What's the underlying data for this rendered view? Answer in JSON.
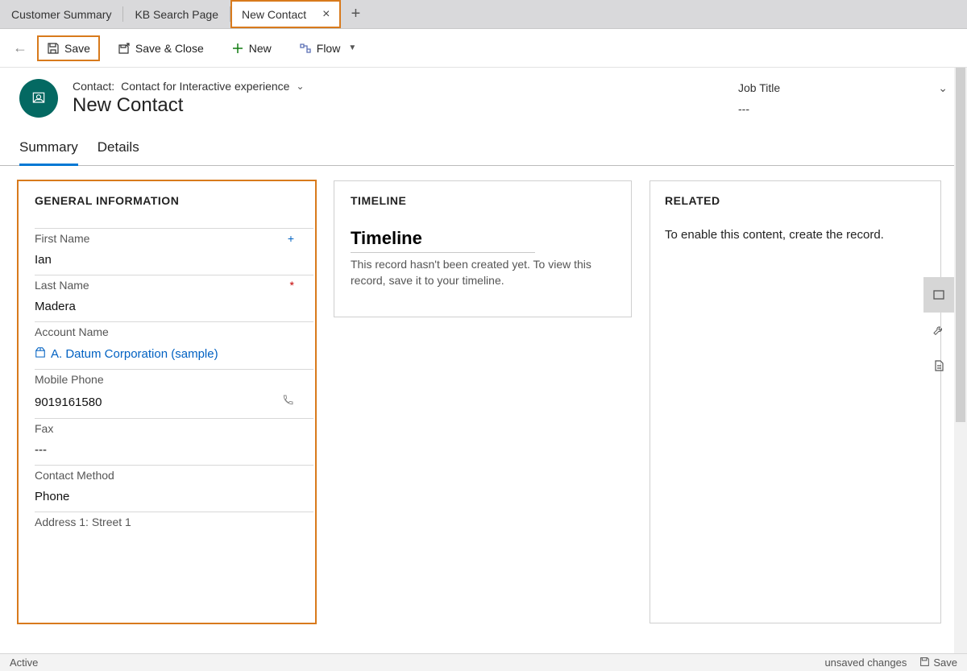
{
  "tabs": [
    {
      "label": "Customer Summary",
      "active": false
    },
    {
      "label": "KB Search Page",
      "active": false
    },
    {
      "label": "New Contact",
      "active": true,
      "highlighted": true
    }
  ],
  "commands": {
    "save": "Save",
    "save_close": "Save & Close",
    "new": "New",
    "flow": "Flow"
  },
  "header": {
    "form_type_prefix": "Contact:",
    "form_type": "Contact for Interactive experience",
    "title": "New Contact",
    "attribute_label": "Job Title",
    "attribute_value": "---"
  },
  "section_tabs": [
    {
      "label": "Summary",
      "active": true
    },
    {
      "label": "Details",
      "active": false
    }
  ],
  "general": {
    "heading": "GENERAL INFORMATION",
    "fields": {
      "first_name": {
        "label": "First Name",
        "value": "Ian",
        "recommended": true
      },
      "last_name": {
        "label": "Last Name",
        "value": "Madera",
        "required": true
      },
      "account_name": {
        "label": "Account Name",
        "value": "A. Datum Corporation (sample)",
        "lookup": true
      },
      "mobile_phone": {
        "label": "Mobile Phone",
        "value": "9019161580",
        "phone": true
      },
      "fax": {
        "label": "Fax",
        "value": "---"
      },
      "contact_method": {
        "label": "Contact Method",
        "value": "Phone"
      },
      "address1": {
        "label": "Address 1: Street 1",
        "value": ""
      }
    }
  },
  "timeline": {
    "heading": "TIMELINE",
    "title": "Timeline",
    "message": "This record hasn't been created yet.  To view this record, save it to your timeline."
  },
  "related": {
    "heading": "RELATED",
    "message": "To enable this content, create the record."
  },
  "statusbar": {
    "left": "Active",
    "right": "unsaved changes",
    "save": "Save"
  }
}
